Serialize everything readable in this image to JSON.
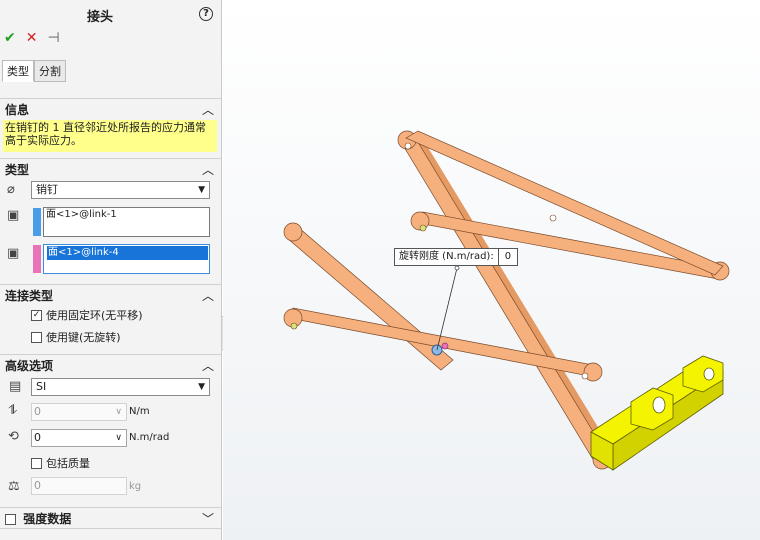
{
  "panel": {
    "title": "接头",
    "help_icon": "?",
    "toolbar": {
      "ok": "✔",
      "cancel": "✕",
      "pin": "⊣"
    },
    "tabs": [
      {
        "label": "类型"
      },
      {
        "label": "分割"
      }
    ],
    "info": {
      "header": "信息",
      "note": "在销钉的 1 直径邻近处所报告的应力通常高于实际应力。"
    },
    "type": {
      "header": "类型",
      "selected_value": "销钉",
      "face1": "面<1>@link-1",
      "face2": "面<1>@link-4",
      "color1": "#4a9be8",
      "color2": "#e973b9"
    },
    "connection": {
      "header": "连接类型",
      "option1_label": "使用固定环(无平移)",
      "option1_checked": true,
      "option2_label": "使用键(无旋转)",
      "option2_checked": false
    },
    "advanced": {
      "header": "高级选项",
      "units_value": "SI",
      "axial_stiffness": "0",
      "axial_unit": "N/m",
      "rotational_stiffness": "0",
      "rotational_unit": "N.m/rad",
      "include_mass_label": "包括质量",
      "mass_value": "0",
      "mass_unit": "kg"
    },
    "strength": {
      "header": "强度数据"
    }
  },
  "viewport": {
    "tooltip_label": "旋转刚度 (N.m/rad):",
    "tooltip_value": "0",
    "link_color": "#f6b07d",
    "base_color": "#f0f000"
  }
}
